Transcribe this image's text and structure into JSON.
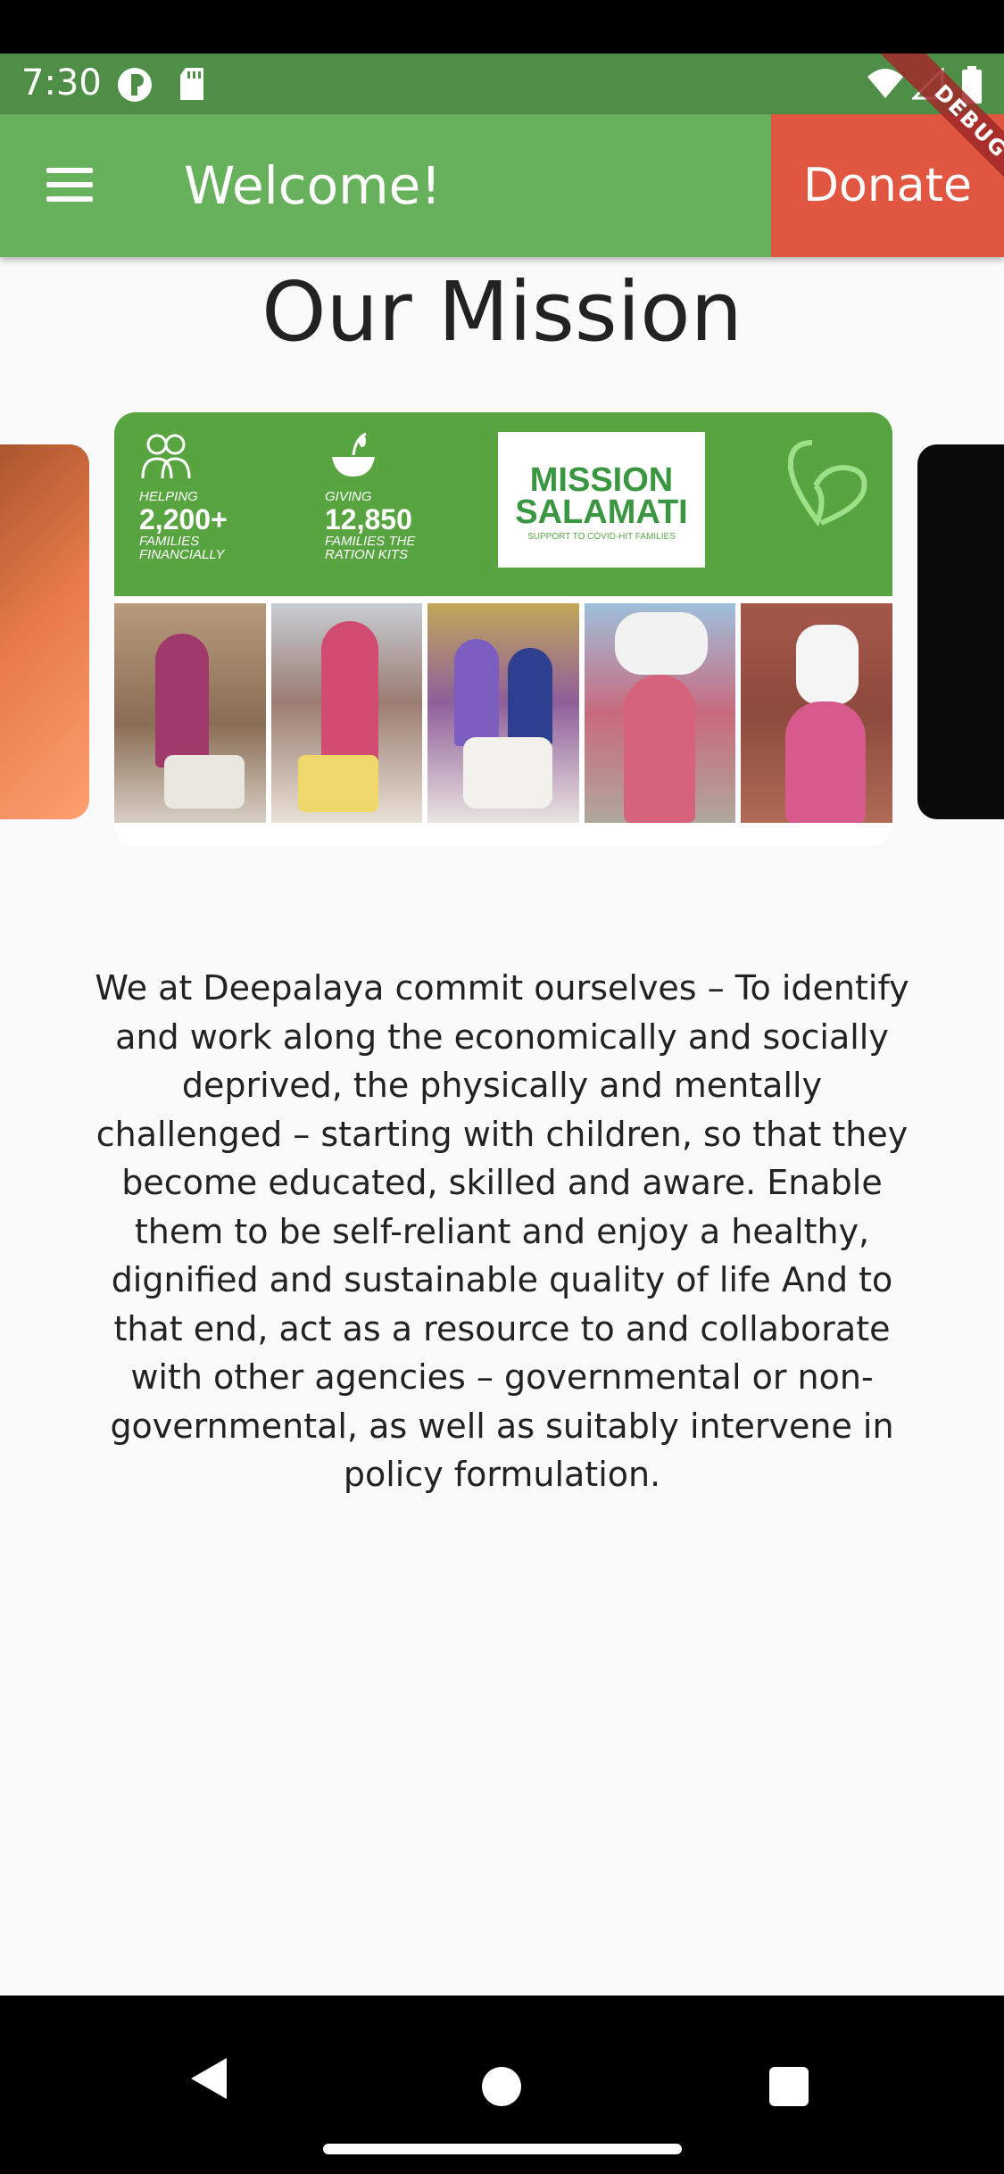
{
  "status_bar": {
    "time": "7:30",
    "icons": [
      "p-circle-icon",
      "sd-card-icon",
      "wifi-icon",
      "signal-icon",
      "battery-icon"
    ]
  },
  "debug_banner": "DEBUG",
  "app_bar": {
    "title": "Welcome!",
    "donate_label": "Donate",
    "menu_icon": "hamburger-menu-icon"
  },
  "main": {
    "heading": "Our Mission",
    "carousel": {
      "banner": {
        "stat1": {
          "label": "HELPING",
          "value": "2,200+",
          "caption": "FAMILIES FINANCIALLY"
        },
        "stat2": {
          "label": "GIVING",
          "value": "12,850",
          "caption": "FAMILIES THE RATION KITS"
        },
        "logo_line1": "MISSION",
        "logo_line2": "SALAMATI",
        "logo_tagline": "SUPPORT TO COVID-HIT FAMILIES"
      }
    },
    "description": "We at Deepalaya commit ourselves – To identify and work along the economically and socially deprived, the physically and mentally challenged – starting with children, so that they become educated, skilled and aware. Enable them to be self-reliant and enjoy a healthy, dignified and sustainable quality of life And to that end, act as a resource to and collaborate with other agencies – governmental or non-governmental, as well as suitably intervene in policy formulation."
  },
  "colors": {
    "app_bar": "#67b05c",
    "status_bar": "#4f8e46",
    "donate": "#e15640",
    "banner": "#58a440"
  },
  "nav_bar": {
    "buttons": [
      "back-icon",
      "home-icon",
      "recents-icon"
    ]
  }
}
